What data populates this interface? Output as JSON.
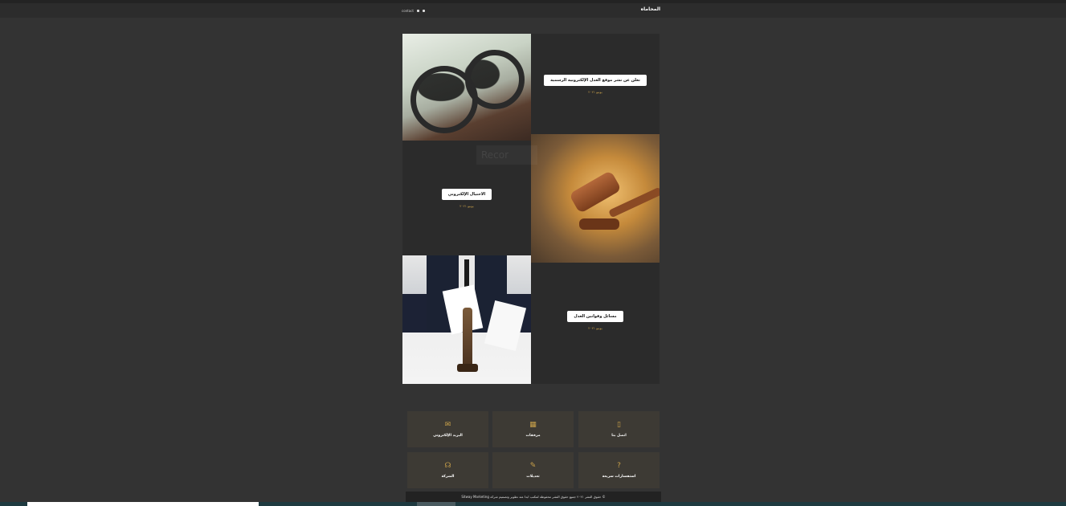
{
  "header": {
    "brand": "المحاماه",
    "small_link": "contact",
    "icons": [
      "user-icon",
      "search-icon"
    ]
  },
  "posts": [
    {
      "title": "تعلن عن نشر موقع العدل الإلكترونية الرسمية",
      "date": "يونيو ٢٠٢١"
    },
    {
      "title": "الاحتيال الإلكتروني",
      "date": "يونيو ٢٠٢١"
    },
    {
      "title": "مسائل وقوانين العدل",
      "date": "يونيو ٢٠٢١"
    }
  ],
  "watermark_text": "Recor",
  "features": [
    {
      "label": "البريد الإلكتروني",
      "icon": "envelope-open-icon"
    },
    {
      "label": "مرفقات",
      "icon": "map-icon"
    },
    {
      "label": "اتصل بنا",
      "icon": "mobile-icon"
    },
    {
      "label": "الشركة",
      "icon": "rss-icon"
    },
    {
      "label": "تعديلات",
      "icon": "edit-icon"
    },
    {
      "label": "استفسارات سريعة",
      "icon": "question-icon"
    }
  ],
  "footer": {
    "text": "© حقوق النشر ٢٠٢١ جميع حقوق النشر محفوظة لمكتب ابدا عند تطوير وتصميم شركة Sitway Marketing"
  }
}
